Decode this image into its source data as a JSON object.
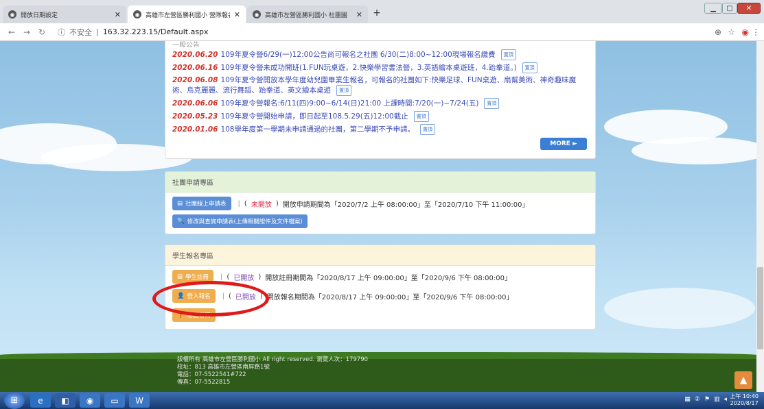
{
  "browser": {
    "tabs": [
      {
        "title": "開放日期設定",
        "active": false
      },
      {
        "title": "高雄市左營區勝利國小 營隊報名",
        "active": true
      },
      {
        "title": "高雄市左營區勝利國小 社團園",
        "active": false
      }
    ],
    "new_tab_symbol": "+",
    "address": {
      "security": "不安全",
      "host": "163.32.223.15/Default.aspx"
    }
  },
  "notices": {
    "header_partial": "一般公告",
    "items": [
      {
        "date": "2020.06.20",
        "text": "109年夏令營6/29(一)12:00公告尚可報名之社團 6/30(二)8:00~12:00現場報名繳費",
        "badge": "置頂"
      },
      {
        "date": "2020.06.16",
        "text": "109年夏令營未成功開班(1.FUN玩桌遊，2.快樂學習書法營，3.英語繪本桌遊班，4.跆拳道。)",
        "badge": "置頂"
      },
      {
        "date": "2020.06.08",
        "text": "109年夏令營開放本學年度幼兒園畢業生報名，可報名的社團如下:快樂足球、FUN桌遊、扇幫美術、神奇趣味魔術、烏克麗麗、流行舞蹈、跆拳道、英文繪本桌遊",
        "badge": "置頂"
      },
      {
        "date": "2020.06.06",
        "text": "109年夏令營報名:6/11(四)9:00~6/14(日)21:00 上課時間:7/20(一)~7/24(五)",
        "badge": "置頂"
      },
      {
        "date": "2020.05.23",
        "text": "109年夏令營開始申請，即日起至108.5.29(五)12:00截止",
        "badge": "置頂"
      },
      {
        "date": "2020.01.06",
        "text": "108學年度第一學期未申請通過的社團，第二學期不予申請。",
        "badge": "置頂"
      }
    ],
    "more_label": "MORE ►"
  },
  "club_apply": {
    "title": "社團申請專區",
    "online_form_button": "社團線上申請表",
    "status": "未開放",
    "period_text": "開放申請期間為「2020/7/2 上午 08:00:00」至「2020/7/10 下午 11:00:00」",
    "query_button": "修改與查詢申請表(上傳相關證件及文件檔案)"
  },
  "student_signup": {
    "title": "學生報名專區",
    "register_button": "學生註冊",
    "register_status": "已開放",
    "register_period": "開放註冊期間為「2020/8/17 上午 09:00:00」至「2020/9/6 下午 08:00:00」",
    "login_button": "登入報名",
    "login_status": "已開放",
    "login_period": "開放報名期間為「2020/8/17 上午 09:00:00」至「2020/9/6 下午 08:00:00」",
    "third_button": "忘記密碼"
  },
  "footer": {
    "line1": "版權所有 高雄市左營區勝利國小 All right reserved. 瀏覽人次：179790",
    "line2": "校址：813 高雄市左營區南屏路1號",
    "line3": "電話：07-5522541#722",
    "line4": "傳真：07-5522815"
  },
  "taskbar": {
    "time": "上午 10:40",
    "date": "2020/8/17"
  },
  "colors": {
    "date_red": "#d0342c",
    "link_blue": "#3b4bb5",
    "highlight_ellipse": "#e0191b"
  }
}
